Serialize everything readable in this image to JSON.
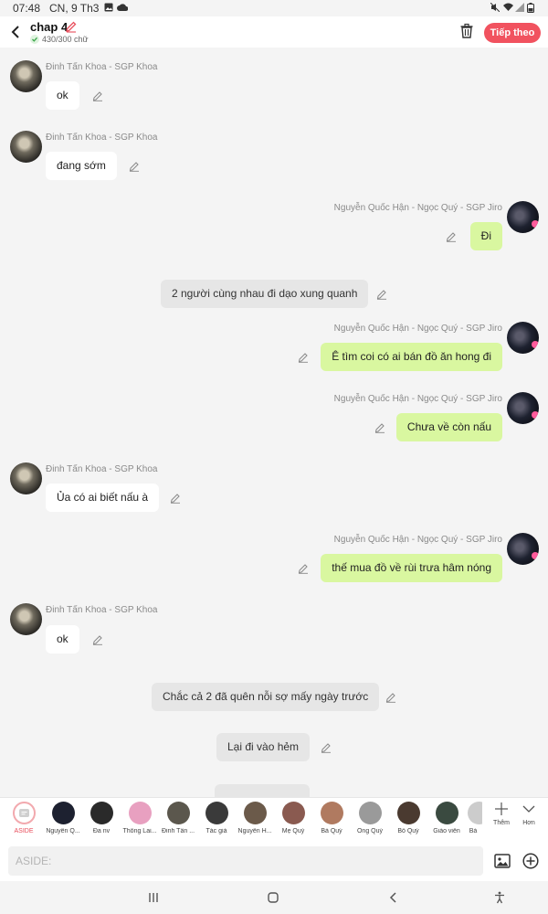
{
  "status": {
    "time": "07:48",
    "date": "CN, 9 Th3"
  },
  "header": {
    "title": "chap 4",
    "word_count": "430/300 chữ",
    "next_label": "Tiếp theo"
  },
  "messages": [
    {
      "type": "left",
      "name": "Đinh Tấn Khoa - SGP Khoa",
      "text": "ok"
    },
    {
      "type": "left",
      "name": "Đinh Tấn Khoa - SGP Khoa",
      "text": "đang sớm"
    },
    {
      "type": "right",
      "name": "Nguyễn Quốc Hận - Ngọc Quý - SGP Jiro",
      "text": "Đi"
    },
    {
      "type": "aside",
      "text": "2 người cùng nhau đi dạo xung quanh"
    },
    {
      "type": "right",
      "name": "Nguyễn Quốc Hận - Ngọc Quý - SGP Jiro",
      "text": "Ê tìm coi có ai bán đồ ăn hong đi"
    },
    {
      "type": "right",
      "name": "Nguyễn Quốc Hận - Ngọc Quý - SGP Jiro",
      "text": "Chưa về còn nấu"
    },
    {
      "type": "left",
      "name": "Đinh Tấn Khoa - SGP Khoa",
      "text": "Ủa có ai biết nấu à"
    },
    {
      "type": "right",
      "name": "Nguyễn Quốc Hận - Ngọc Quý - SGP Jiro",
      "text": "thế mua đồ về rùi trưa hâm nóng"
    },
    {
      "type": "left",
      "name": "Đinh Tấn Khoa - SGP Khoa",
      "text": "ok"
    },
    {
      "type": "aside",
      "text": "Chắc cả 2 đã quên nỗi sợ mấy ngày trước"
    },
    {
      "type": "aside",
      "text": "Lại đi vào hẻm"
    }
  ],
  "characters": [
    {
      "label": "ASIDE",
      "color": "#ffffff",
      "selected": true
    },
    {
      "label": "Nguyễn Q...",
      "color": "#1d2130"
    },
    {
      "label": "Đa nv",
      "color": "#2a2a2a"
    },
    {
      "label": "Thông Lai...",
      "color": "#e8a0c0"
    },
    {
      "label": "Đinh Tấn ...",
      "color": "#5b574d"
    },
    {
      "label": "Tác giả",
      "color": "#3a3a3a"
    },
    {
      "label": "Nguyễn H...",
      "color": "#6b5a4a"
    },
    {
      "label": "Mẹ Quý",
      "color": "#8a5a50"
    },
    {
      "label": "Bà Quý",
      "color": "#b07a60"
    },
    {
      "label": "Ông Quý",
      "color": "#9a9a9a"
    },
    {
      "label": "Bố Quý",
      "color": "#4a3a30"
    },
    {
      "label": "Giáo viên",
      "color": "#3a4a40"
    },
    {
      "label": "Bá",
      "color": "#cccccc"
    }
  ],
  "tools": {
    "more_label": "Thêm",
    "expand_label": "Hơn"
  },
  "input": {
    "placeholder": "ASIDE:"
  },
  "colors": {
    "accent": "#f1525f",
    "right_bubble": "#d9f7a0",
    "aside_bubble": "#e6e6e6"
  }
}
